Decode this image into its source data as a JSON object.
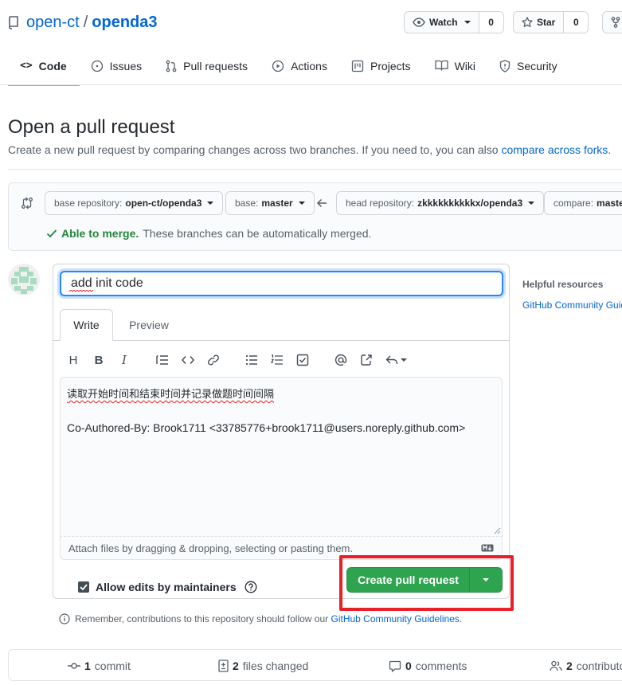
{
  "repo": {
    "owner": "open-ct",
    "separator": "/",
    "name": "openda3"
  },
  "watch": {
    "label": "Watch",
    "count": "0"
  },
  "star": {
    "label": "Star",
    "count": "0"
  },
  "tabs": [
    {
      "label": "Code"
    },
    {
      "label": "Issues"
    },
    {
      "label": "Pull requests"
    },
    {
      "label": "Actions"
    },
    {
      "label": "Projects"
    },
    {
      "label": "Wiki"
    },
    {
      "label": "Security"
    }
  ],
  "page": {
    "title": "Open a pull request",
    "subtitle": "Create a new pull request by comparing changes across two branches. If you need to, you can also ",
    "subtitle_link": "compare across forks",
    "subtitle_end": "."
  },
  "range": {
    "base_repo_label": "base repository:",
    "base_repo_value": "open-ct/openda3",
    "base_label": "base:",
    "base_value": "master",
    "head_repo_label": "head repository:",
    "head_repo_value": "zkkkkkkkkkkx/openda3",
    "compare_label": "compare:",
    "compare_value": "master",
    "merge_status": "Able to merge.",
    "merge_detail": " These branches can be automatically merged."
  },
  "form": {
    "title_value": "add init code",
    "tab_write": "Write",
    "tab_preview": "Preview",
    "body_line1": "读取开始时间和结束时间并记录做题时间间隔",
    "body_line2": "Co-Authored-By: Brook1711 <33785776+brook1711@users.noreply.github.com>",
    "attach_hint": "Attach files by dragging & dropping, selecting or pasting them.",
    "allow_edits": "Allow edits by maintainers",
    "create_button": "Create pull request"
  },
  "remember": {
    "text": "Remember, contributions to this repository should follow our ",
    "link": "GitHub Community Guidelines",
    "end": "."
  },
  "sidebar": {
    "heading": "Helpful resources",
    "link": "GitHub Community Guidelines"
  },
  "summary": {
    "commits_count": "1",
    "commits_label": "commit",
    "files_count": "2",
    "files_label": "files changed",
    "comments_count": "0",
    "comments_label": "comments",
    "contributors_count": "2",
    "contributors_label": "contributors"
  },
  "colors": {
    "link": "#0366d6",
    "primary_button": "#2ea44f",
    "highlight_box": "#e8202a",
    "success_text": "#22863a",
    "active_tab_underline": "#f9826c"
  }
}
